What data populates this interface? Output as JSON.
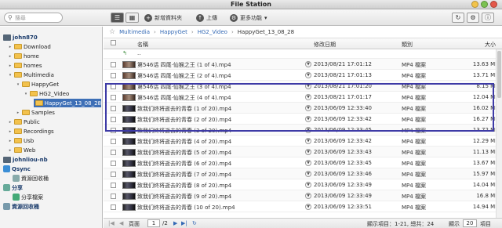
{
  "window": {
    "title": "File Station"
  },
  "toolbar": {
    "search_placeholder": "搜尋",
    "new_folder": "新增資料夾",
    "upload": "上傳",
    "more": "更多功能"
  },
  "sidebar": {
    "root": "john870",
    "items": [
      {
        "label": "Download",
        "level": 1
      },
      {
        "label": "home",
        "level": 1
      },
      {
        "label": "homes",
        "level": 1
      },
      {
        "label": "Multimedia",
        "level": 1
      },
      {
        "label": "HappyGet",
        "level": 2
      },
      {
        "label": "HG2_Video",
        "level": 3
      },
      {
        "label": "HappyGet_13_08_28",
        "level": 4,
        "selected": true
      },
      {
        "label": "Samples",
        "level": 2
      },
      {
        "label": "Public",
        "level": 1
      },
      {
        "label": "Recordings",
        "level": 1
      },
      {
        "label": "Usb",
        "level": 1
      },
      {
        "label": "Web",
        "level": 1
      }
    ],
    "nodes": [
      {
        "label": "johnliou-nb"
      },
      {
        "label": "Qsync"
      },
      {
        "label": "資源回收桶"
      },
      {
        "label": "分享"
      },
      {
        "label": "分享檔案"
      },
      {
        "label": "資源回收桶"
      }
    ]
  },
  "breadcrumb": [
    "Multimedia",
    "HappyGet",
    "HG2_Video",
    "HappyGet_13_08_28"
  ],
  "columns": {
    "name": "名稱",
    "modified": "修改日期",
    "type": "類別",
    "size": "大小"
  },
  "parent_dir": "..",
  "files": [
    {
      "name": "第546话 四尾·仙猴之王 (1 of 4).mp4",
      "date": "2013/08/21 17:01:12",
      "type": "MP4 檔案",
      "size": "13.63 MB",
      "thumb": "a"
    },
    {
      "name": "第546话 四尾·仙猴之王 (2 of 4).mp4",
      "date": "2013/08/21 17:01:13",
      "type": "MP4 檔案",
      "size": "13.71 MB",
      "thumb": "a"
    },
    {
      "name": "第546话 四尾·仙猴之王 (3 of 4).mp4",
      "date": "2013/08/21 17:01:20",
      "type": "MP4 檔案",
      "size": "8.15 MB",
      "thumb": "a"
    },
    {
      "name": "第546话 四尾·仙猴之王 (4 of 4).mp4",
      "date": "2013/08/21 17:01:17",
      "type": "MP4 檔案",
      "size": "12.04 MB",
      "thumb": "a"
    },
    {
      "name": "致我们终将逝去的青春 (1 of 20).mp4",
      "date": "2013/06/09 12:33:40",
      "type": "MP4 檔案",
      "size": "16.02 MB",
      "thumb": "b"
    },
    {
      "name": "致我们终将逝去的青春 (2 of 20).mp4",
      "date": "2013/06/09 12:33:42",
      "type": "MP4 檔案",
      "size": "16.27 MB",
      "thumb": "b"
    },
    {
      "name": "致我们终将逝去的青春 (3 of 20).mp4",
      "date": "2013/06/09 12:33:45",
      "type": "MP4 檔案",
      "size": "13.72 MB",
      "thumb": "b"
    },
    {
      "name": "致我们终将逝去的青春 (4 of 20).mp4",
      "date": "2013/06/09 12:33:42",
      "type": "MP4 檔案",
      "size": "12.29 MB",
      "thumb": "b"
    },
    {
      "name": "致我们终将逝去的青春 (5 of 20).mp4",
      "date": "2013/06/09 12:33:43",
      "type": "MP4 檔案",
      "size": "11.13 MB",
      "thumb": "b"
    },
    {
      "name": "致我们终将逝去的青春 (6 of 20).mp4",
      "date": "2013/06/09 12:33:45",
      "type": "MP4 檔案",
      "size": "13.67 MB",
      "thumb": "b"
    },
    {
      "name": "致我们终将逝去的青春 (7 of 20).mp4",
      "date": "2013/06/09 12:33:46",
      "type": "MP4 檔案",
      "size": "15.97 MB",
      "thumb": "b"
    },
    {
      "name": "致我们终将逝去的青春 (8 of 20).mp4",
      "date": "2013/06/09 12:33:49",
      "type": "MP4 檔案",
      "size": "14.04 MB",
      "thumb": "b"
    },
    {
      "name": "致我们终将逝去的青春 (9 of 20).mp4",
      "date": "2013/06/09 12:33:49",
      "type": "MP4 檔案",
      "size": "16.8 MB",
      "thumb": "b"
    },
    {
      "name": "致我们终将逝去的青春 (10 of 20).mp4",
      "date": "2013/06/09 12:33:51",
      "type": "MP4 檔案",
      "size": "14.94 MB",
      "thumb": "b"
    }
  ],
  "pager": {
    "page_label": "頁面",
    "page": "1",
    "of_pages": "/2",
    "display": "顯示項目：1-21, 總共：24",
    "show": "顯示",
    "per_page": "20",
    "unit": "項目"
  },
  "colors": {
    "accent": "#3d6fb6",
    "highlight_box": "#3d3aa6",
    "link": "#3369b5"
  }
}
